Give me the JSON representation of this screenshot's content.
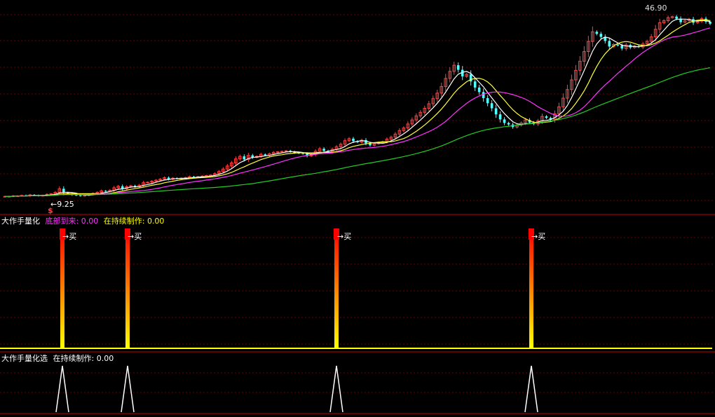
{
  "colors": {
    "background": "#000000",
    "panel_border": "#c00000",
    "grid": "#6e0000",
    "candle_up": "#ff4040",
    "candle_down": "#54ffff",
    "ma5": "#ffffff",
    "ma10": "#ffff33",
    "ma20": "#ff33ff",
    "ma60": "#22cc22",
    "signal_low": "#ffff00",
    "signal_high": "#ff0000",
    "indicator2": "#ffffff",
    "text_white": "#ffffff",
    "text_magenta": "#ff33ff",
    "text_yellow": "#ffff00"
  },
  "price_panel": {
    "low_marker": "←9.25",
    "high_marker": "46.90",
    "signal_glyph": "$"
  },
  "indicator1": {
    "name": "大作手量化",
    "field1_label": "底部到来:",
    "field1_value": "0.00",
    "field2_label": "在持续制作:",
    "field2_value": "0.00",
    "buy_label": "→买"
  },
  "indicator2": {
    "name": "大作手量化选",
    "field1_label": "在持续制作:",
    "field1_value": "0.00"
  },
  "chart_data": {
    "type": "candlestick",
    "x": [
      1,
      2,
      3,
      4,
      5,
      6,
      7,
      8,
      9,
      10,
      11,
      12,
      13,
      14,
      15,
      16,
      17,
      18,
      19,
      20,
      21,
      22,
      23,
      24,
      25,
      26,
      27,
      28,
      29,
      30,
      31,
      32,
      33,
      34,
      35,
      36,
      37,
      38,
      39,
      40,
      41,
      42,
      43,
      44,
      45,
      46,
      47,
      48,
      49,
      50,
      51,
      52,
      53,
      54,
      55,
      56,
      57,
      58,
      59,
      60,
      61,
      62,
      63,
      64,
      65,
      66,
      67,
      68,
      69,
      70,
      71,
      72,
      73,
      74,
      75,
      76,
      77,
      78,
      79,
      80,
      81,
      82,
      83,
      84,
      85,
      86,
      87,
      88,
      89,
      90,
      91,
      92,
      93,
      94,
      95,
      96,
      97,
      98,
      99,
      100,
      101,
      102,
      103,
      104,
      105,
      106,
      107,
      108,
      109,
      110,
      111,
      112,
      113,
      114,
      115,
      116,
      117,
      118,
      119,
      120,
      121,
      122,
      123,
      124,
      125,
      126,
      127,
      128,
      129,
      130,
      131,
      132,
      133,
      134,
      135,
      136,
      137,
      138,
      139,
      140,
      141,
      142,
      143,
      144,
      145,
      146,
      147,
      148,
      149,
      150,
      151,
      152,
      153,
      154,
      155,
      156,
      157,
      158,
      159,
      160,
      161,
      162,
      163,
      164,
      165,
      166,
      167,
      168,
      169
    ],
    "close": [
      9.5,
      9.5,
      9.6,
      9.6,
      9.7,
      9.6,
      9.8,
      9.7,
      9.6,
      9.7,
      9.9,
      10.0,
      10.3,
      11.0,
      10.2,
      10.0,
      9.8,
      9.7,
      9.6,
      9.7,
      9.9,
      10.1,
      10.3,
      10.6,
      10.5,
      10.7,
      11.2,
      11.5,
      11.0,
      11.4,
      11.6,
      11.4,
      11.7,
      12.2,
      12.3,
      12.5,
      12.7,
      12.9,
      13.2,
      12.9,
      13.1,
      13.0,
      13.1,
      13.2,
      13.4,
      13.3,
      13.4,
      13.5,
      13.6,
      13.7,
      14.0,
      14.4,
      14.9,
      15.5,
      16.1,
      16.9,
      17.4,
      16.8,
      17.6,
      17.2,
      17.4,
      17.8,
      17.6,
      17.9,
      18.2,
      18.3,
      18.4,
      18.5,
      18.3,
      18.1,
      18.0,
      17.9,
      17.5,
      17.8,
      18.4,
      18.9,
      18.5,
      18.3,
      18.8,
      19.3,
      19.8,
      20.5,
      20.9,
      20.4,
      20.2,
      20.6,
      20.0,
      19.6,
      19.9,
      20.1,
      20.3,
      20.8,
      21.2,
      21.8,
      22.5,
      23.0,
      23.8,
      24.6,
      25.4,
      26.1,
      26.9,
      27.8,
      28.8,
      29.9,
      31.2,
      32.8,
      34.2,
      35.4,
      34.5,
      33.2,
      33.6,
      32.2,
      31.0,
      30.1,
      28.9,
      27.9,
      26.9,
      25.7,
      24.7,
      24.0,
      23.7,
      23.2,
      23.6,
      24.0,
      24.6,
      24.1,
      23.8,
      24.4,
      25.3,
      25.0,
      24.7,
      25.8,
      27.2,
      28.9,
      30.6,
      32.5,
      34.4,
      36.2,
      38.1,
      40.1,
      42.0,
      41.6,
      41.0,
      40.2,
      39.1,
      39.5,
      39.3,
      38.7,
      39.4,
      38.9,
      39.2,
      39.0,
      39.6,
      40.1,
      41.0,
      42.5,
      43.8,
      44.2,
      44.8,
      45.0,
      44.6,
      43.9,
      44.2,
      44.5,
      43.8,
      44.1,
      44.6,
      44.0,
      43.6
    ],
    "price_range": [
      9.25,
      46.9
    ],
    "buy_signal_bars": [
      21,
      44,
      119,
      189
    ],
    "indicator1_values": {
      "field1": 0.0,
      "field2": 0.0
    },
    "indicator2_values": {
      "field1": 0.0
    }
  }
}
